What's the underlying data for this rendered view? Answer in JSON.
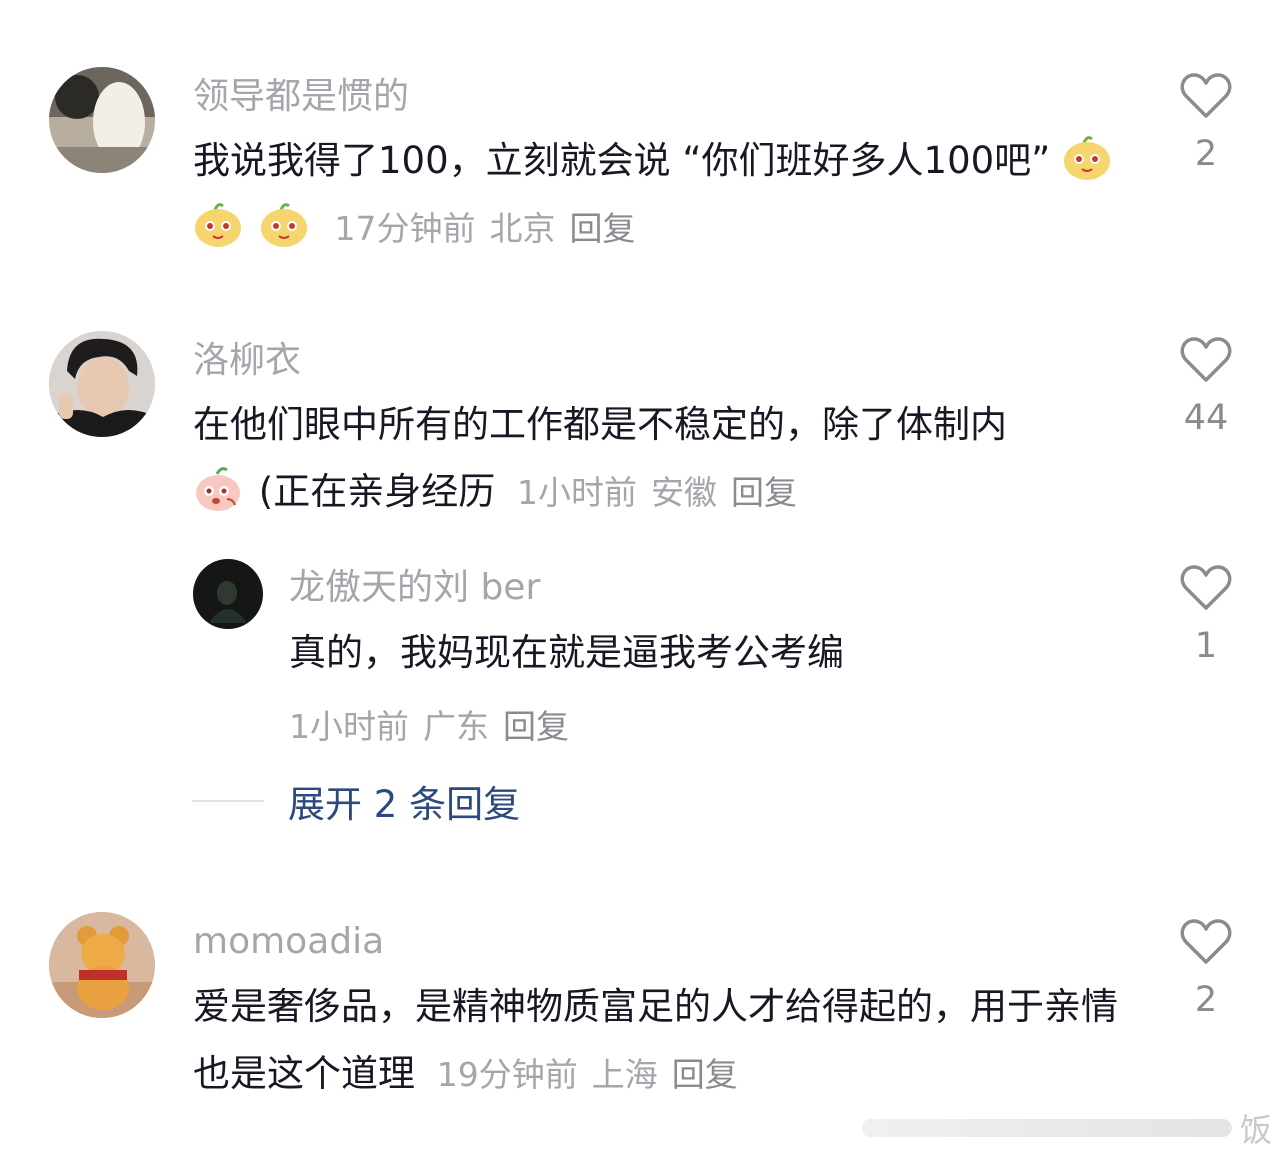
{
  "comments": [
    {
      "username": "领导都是惯的",
      "text": "我说我得了100，立刻就会说 “你们班好多人100吧”",
      "time": "17分钟前",
      "location": "北京",
      "reply_label": "回复",
      "likes": "2",
      "emoji": "fruit-face-emoji"
    },
    {
      "username": "洛柳衣",
      "text": "在他们眼中所有的工作都是不稳定的，除了体制内",
      "text_after_emoji": "(正在亲身经历",
      "time": "1小时前",
      "location": "安徽",
      "reply_label": "回复",
      "likes": "44",
      "emoji": "peach-face-emoji",
      "replies": [
        {
          "username": "龙傲天的刘 ber",
          "text": "真的，我妈现在就是逼我考公考编",
          "time": "1小时前",
          "location": "广东",
          "reply_label": "回复",
          "likes": "1"
        }
      ],
      "expand_label": "展开 2 条回复"
    },
    {
      "username": "momoadia",
      "text": "爱是奢侈品，是精神物质富足的人才给得起的，用于亲情也是这个道理",
      "time": "19分钟前",
      "location": "上海",
      "reply_label": "回复",
      "likes": "2"
    }
  ],
  "icons": {
    "like": "heart-outline-icon"
  },
  "colors": {
    "username": "#a5a6ab",
    "text": "#161823",
    "expand": "#2c4a7c"
  },
  "watermark": "饭"
}
